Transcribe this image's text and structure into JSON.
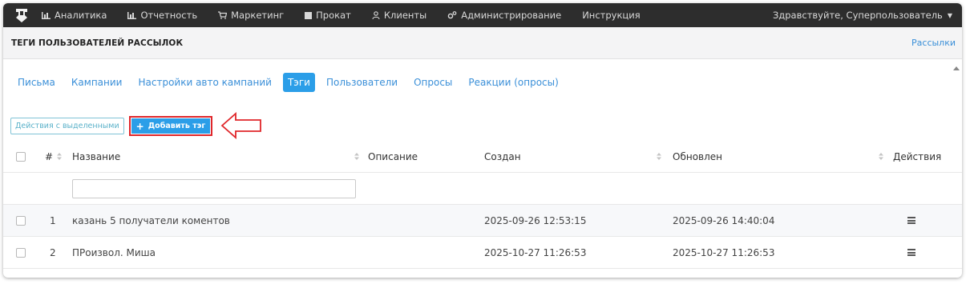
{
  "navbar": {
    "items": [
      {
        "label": "Аналитика",
        "icon": "bar-chart-icon"
      },
      {
        "label": "Отчетность",
        "icon": "bar-chart-icon"
      },
      {
        "label": "Маркетинг",
        "icon": "cart-icon"
      },
      {
        "label": "Прокат",
        "icon": "square-icon"
      },
      {
        "label": "Клиенты",
        "icon": "user-icon"
      },
      {
        "label": "Администрирование",
        "icon": "gears-icon"
      },
      {
        "label": "Инструкция",
        "icon": ""
      }
    ],
    "greeting": "Здравствуйте, Суперпользователь"
  },
  "header": {
    "title": "ТЕГИ ПОЛЬЗОВАТЕЛЕЙ РАССЫЛОК",
    "link": "Рассылки"
  },
  "tabs": [
    {
      "label": "Письма",
      "active": false
    },
    {
      "label": "Кампании",
      "active": false
    },
    {
      "label": "Настройки авто кампаний",
      "active": false
    },
    {
      "label": "Тэги",
      "active": true
    },
    {
      "label": "Пользователи",
      "active": false
    },
    {
      "label": "Опросы",
      "active": false
    },
    {
      "label": "Реакции (опросы)",
      "active": false
    }
  ],
  "toolbar": {
    "bulk_actions_label": "Действия с выделенными",
    "add_tag_label": "Добавить тэг"
  },
  "table": {
    "columns": {
      "number": "#",
      "name": "Название",
      "description": "Описание",
      "created": "Создан",
      "updated": "Обновлен",
      "actions": "Действия"
    },
    "filter_placeholder": "",
    "rows": [
      {
        "number": "1",
        "name": "казань 5 получатели коментов",
        "description": "",
        "created": "2025-09-26 12:53:15",
        "updated": "2025-09-26 14:40:04"
      },
      {
        "number": "2",
        "name": "ПРоизвол. Миша",
        "description": "",
        "created": "2025-10-27 11:26:53",
        "updated": "2025-10-27 11:26:53"
      }
    ]
  },
  "colors": {
    "navbar_bg": "#2d2d2d",
    "accent": "#2b9ee8",
    "link": "#3a8fd8",
    "annotation": "#e0262a"
  }
}
